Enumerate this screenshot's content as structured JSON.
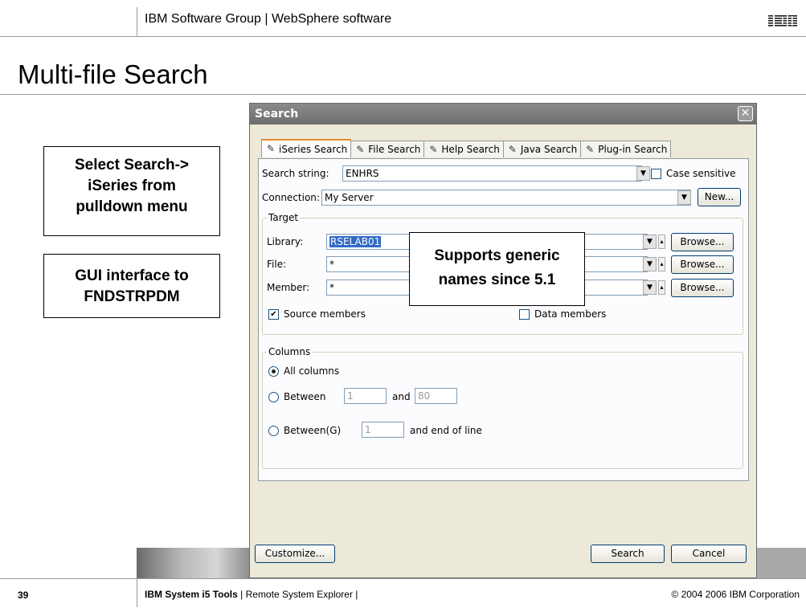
{
  "slide": {
    "header": "IBM Software Group  |  WebSphere software",
    "logo_text": "IBM",
    "title": "Multi-file Search",
    "notes": [
      "Select Search->\niSeries from\npulldown menu",
      "GUI interface to\nFNDSTRPDM"
    ],
    "callout": "Supports generic\nnames since 5.1",
    "footer": {
      "page_number": "39",
      "product": "IBM System i5 Tools",
      "section": " | Remote System Explorer  |",
      "copyright": "© 2004 2006 IBM Corporation"
    }
  },
  "dialog": {
    "title": "Search",
    "close_glyph": "✕",
    "tabs": [
      {
        "label": "iSeries Search",
        "icon": "iseries-search-icon",
        "active": true
      },
      {
        "label": "File Search",
        "icon": "file-search-icon"
      },
      {
        "label": "Help Search",
        "icon": "help-search-icon"
      },
      {
        "label": "Java Search",
        "icon": "java-search-icon"
      },
      {
        "label": "Plug-in Search",
        "icon": "plugin-search-icon"
      }
    ],
    "search_string": {
      "label": "Search string:",
      "value": "ENHRS"
    },
    "case_sensitive": {
      "label": "Case sensitive",
      "checked": false
    },
    "connection": {
      "label": "Connection:",
      "value": "My Server",
      "new_label": "New..."
    },
    "target": {
      "label": "Target",
      "library": {
        "label": "Library:",
        "value": "RSELAB01"
      },
      "file": {
        "label": "File:",
        "value": "*"
      },
      "member": {
        "label": "Member:",
        "value": "*"
      },
      "browse_label": "Browse...",
      "source_members": {
        "label": "Source members",
        "checked": true
      },
      "data_members": {
        "label": "Data members",
        "checked": false
      }
    },
    "columns": {
      "label": "Columns",
      "all_columns": "All columns",
      "between": {
        "label": "Between",
        "from": "1",
        "and_label": "and",
        "to": "80"
      },
      "between_g": {
        "label": "Between(G)",
        "from": "1",
        "end_label": "and end of line"
      },
      "selected": "all"
    },
    "buttons": {
      "customize": "Customize...",
      "search": "Search",
      "cancel": "Cancel"
    }
  },
  "colors": {
    "accent_tab": "#e68b2c",
    "selection": "#316ac5",
    "dialog_bg": "#ece9d8"
  }
}
